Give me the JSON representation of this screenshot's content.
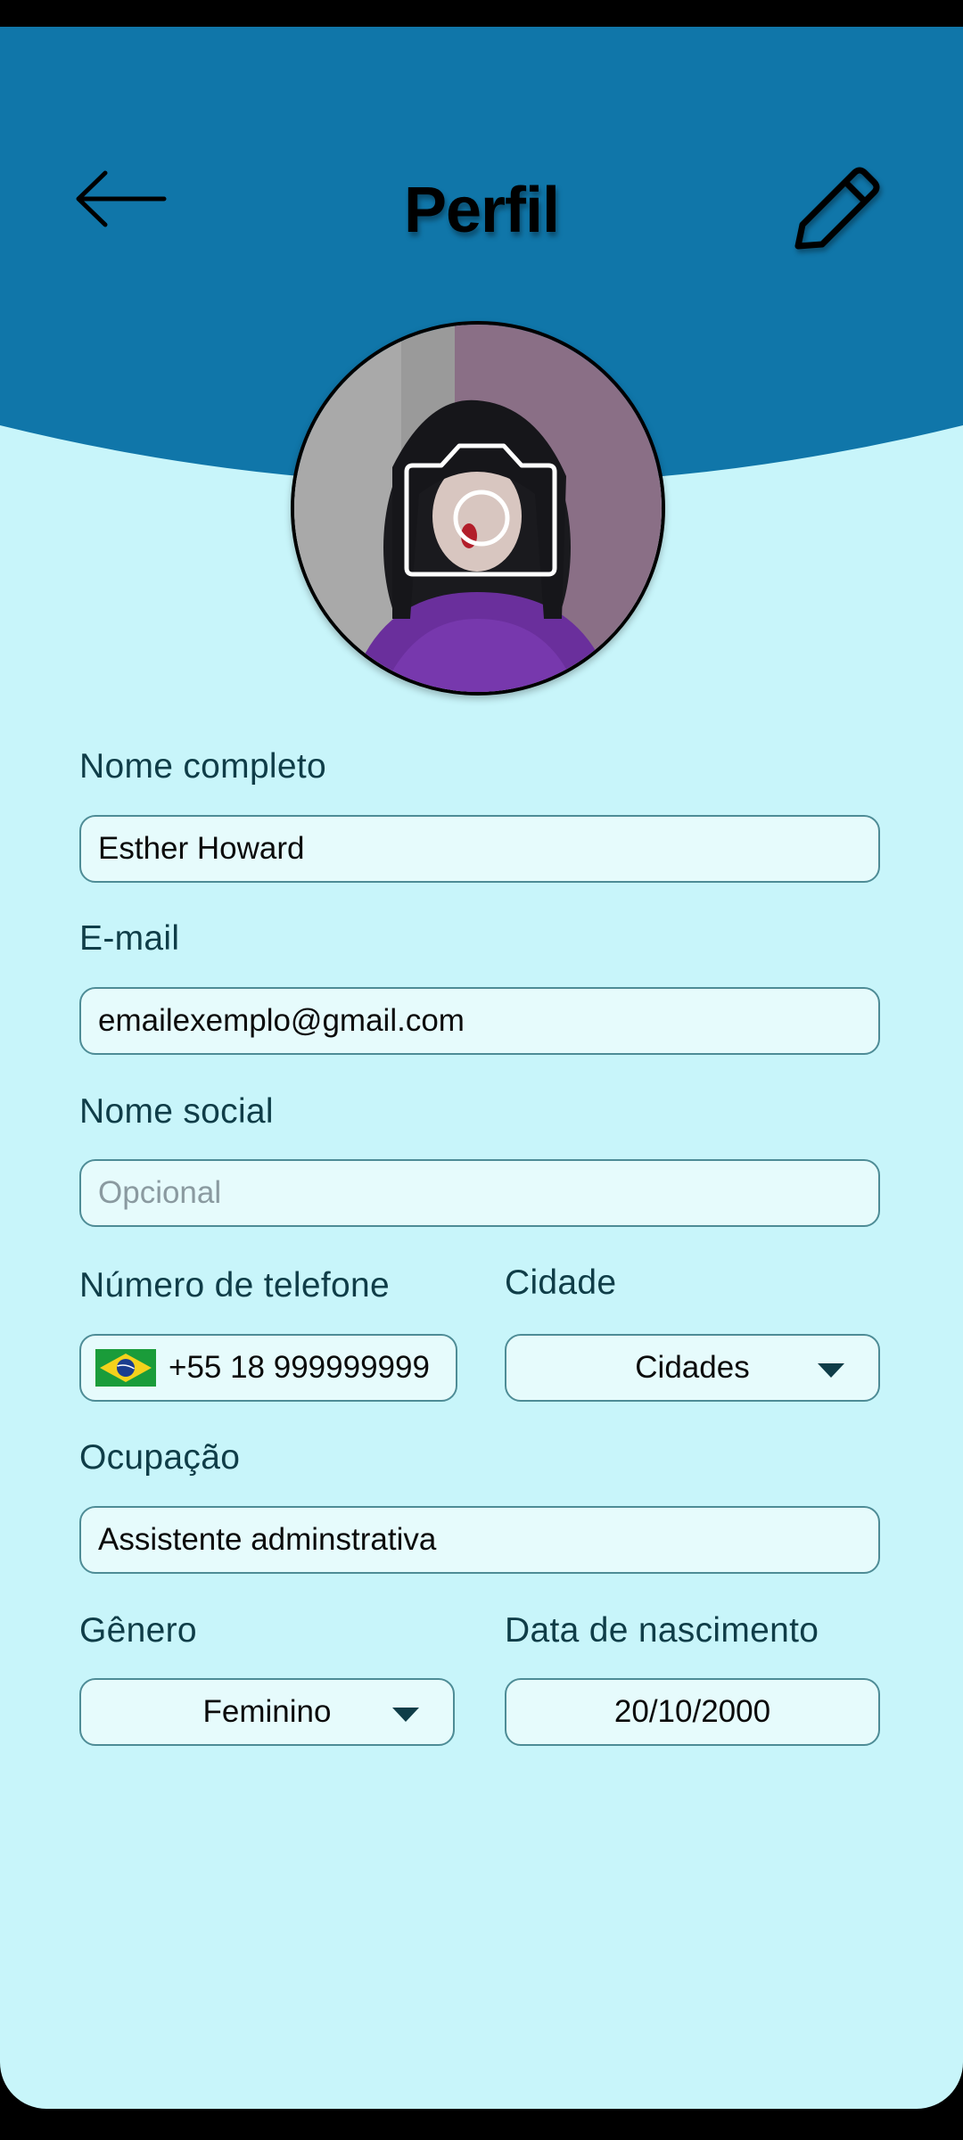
{
  "header": {
    "title": "Perfil"
  },
  "colors": {
    "header_blue": "#1076a9",
    "background": "#c8f5fa",
    "field_fill": "#e6fbfc",
    "field_border": "#4e8c96",
    "label_text": "#0f3d48"
  },
  "icons": {
    "back": "arrow-left-icon",
    "edit": "pencil-icon",
    "photo": "camera-icon",
    "flag": "brazil-flag-icon",
    "dropdown": "caret-down-icon"
  },
  "form": {
    "full_name": {
      "label": "Nome completo",
      "value": "Esther Howard"
    },
    "email": {
      "label": "E-mail",
      "value": "emailexemplo@gmail.com"
    },
    "social_name": {
      "label": "Nome social",
      "placeholder": "Opcional"
    },
    "phone": {
      "label": "Número de telefone",
      "value": "+55 18 999999999"
    },
    "city": {
      "label": "Cidade",
      "value": "Cidades"
    },
    "occupation": {
      "label": "Ocupação",
      "value": "Assistente adminstrativa"
    },
    "gender": {
      "label": "Gênero",
      "value": "Feminino"
    },
    "birth_date": {
      "label": "Data de nascimento",
      "value": "20/10/2000"
    }
  }
}
